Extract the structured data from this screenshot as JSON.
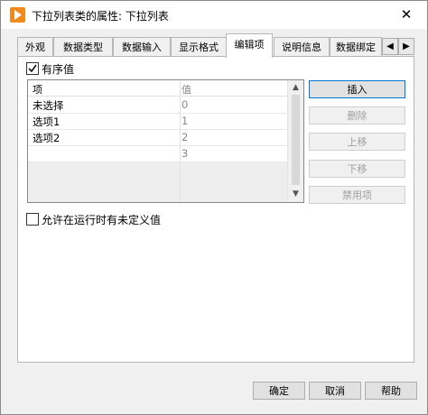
{
  "window": {
    "title": "下拉列表类的属性: 下拉列表",
    "close_glyph": "✕"
  },
  "tabs": [
    "外观",
    "数据类型",
    "数据输入",
    "显示格式",
    "编辑项",
    "说明信息",
    "数据绑定"
  ],
  "tab_scroll": {
    "left": "◀",
    "right": "▶"
  },
  "ordered": {
    "checked": true,
    "label": "有序值"
  },
  "list": {
    "headers": {
      "item": "项",
      "value": "值"
    },
    "rows": [
      {
        "item": "未选择",
        "value": "0"
      },
      {
        "item": "选项1",
        "value": "1"
      },
      {
        "item": "选项2",
        "value": "2"
      },
      {
        "item": "",
        "value": "3"
      }
    ]
  },
  "side_buttons": {
    "insert": "插入",
    "delete": "删除",
    "move_up": "上移",
    "move_down": "下移",
    "disable": "禁用项"
  },
  "allow_undefined": {
    "checked": false,
    "label": "允许在运行时有未定义值"
  },
  "footer": {
    "ok": "确定",
    "cancel": "取消",
    "help": "帮助"
  },
  "icons": {
    "app": "labview-run-icon",
    "check": "checkmark-icon"
  },
  "colors": {
    "accent": "#f08a1c",
    "focus": "#0078d7"
  }
}
